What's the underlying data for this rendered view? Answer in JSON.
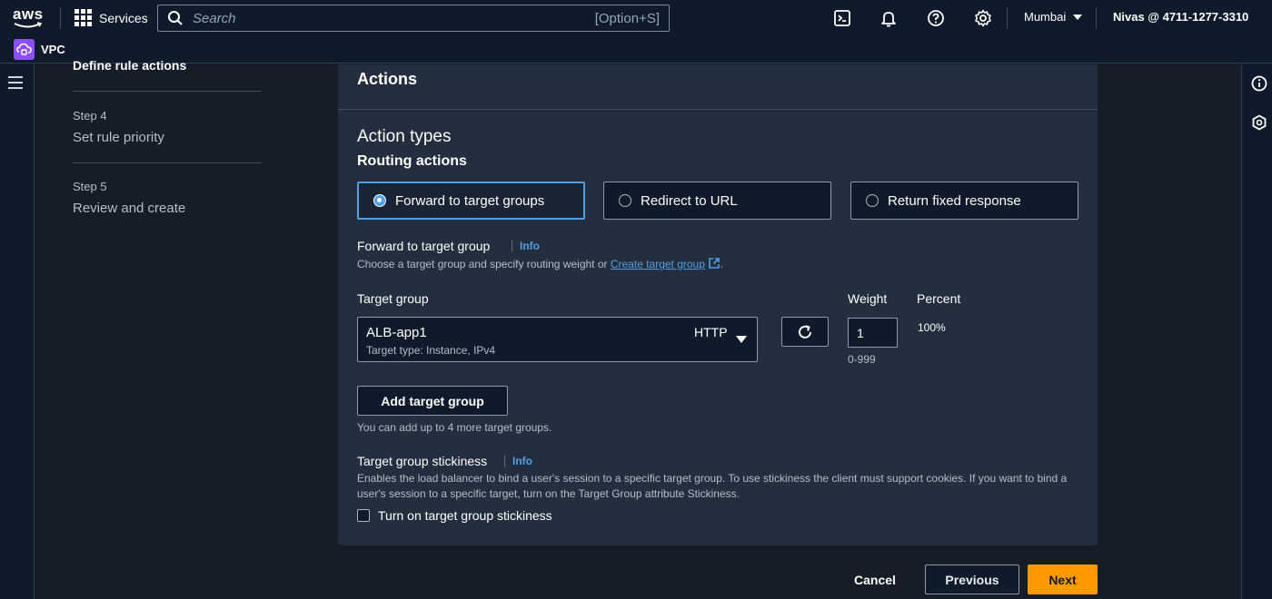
{
  "topnav": {
    "logo_text": "aws",
    "services_label": "Services",
    "search_placeholder": "Search",
    "search_shortcut": "[Option+S]",
    "region": "Mumbai",
    "account": "Nivas @ 4711-1277-3310",
    "icons": [
      "cloudshell-icon",
      "bell-icon",
      "help-icon",
      "settings-icon"
    ]
  },
  "servicebar": {
    "service_name": "VPC"
  },
  "steps": {
    "current_title": "Define rule actions",
    "items": [
      {
        "step": "Step 4",
        "title": "Set rule priority"
      },
      {
        "step": "Step 5",
        "title": "Review and create"
      }
    ]
  },
  "panel": {
    "title": "Actions",
    "action_types_heading": "Action types",
    "routing_heading": "Routing actions",
    "options": [
      {
        "label": "Forward to target groups",
        "selected": true
      },
      {
        "label": "Redirect to URL",
        "selected": false
      },
      {
        "label": "Return fixed response",
        "selected": false
      }
    ],
    "forward": {
      "label": "Forward to target group",
      "info": "Info",
      "desc_prefix": "Choose a target group and specify routing weight or ",
      "create_link": "Create target group",
      "desc_suffix": "."
    },
    "target_group": {
      "label": "Target group",
      "value": "ALB-app1",
      "sub": "Target type: Instance, IPv4",
      "protocol": "HTTP"
    },
    "weight": {
      "label": "Weight",
      "value": "1",
      "hint": "0-999"
    },
    "percent": {
      "label": "Percent",
      "value": "100%"
    },
    "add_button": "Add target group",
    "add_hint": "You can add up to 4 more target groups.",
    "stickiness": {
      "label": "Target group stickiness",
      "info": "Info",
      "desc": "Enables the load balancer to bind a user's session to a specific target group. To use stickiness the client must support cookies. If you want to bind a user's session to a specific target, turn on the Target Group attribute Stickiness.",
      "checkbox_label": "Turn on target group stickiness"
    }
  },
  "footer": {
    "cancel": "Cancel",
    "previous": "Previous",
    "next": "Next"
  },
  "colors": {
    "accent": "#539fe5",
    "primary_button": "#ff9900",
    "nav_bg": "#0f1b2a",
    "panel_bg": "#232f3e"
  }
}
